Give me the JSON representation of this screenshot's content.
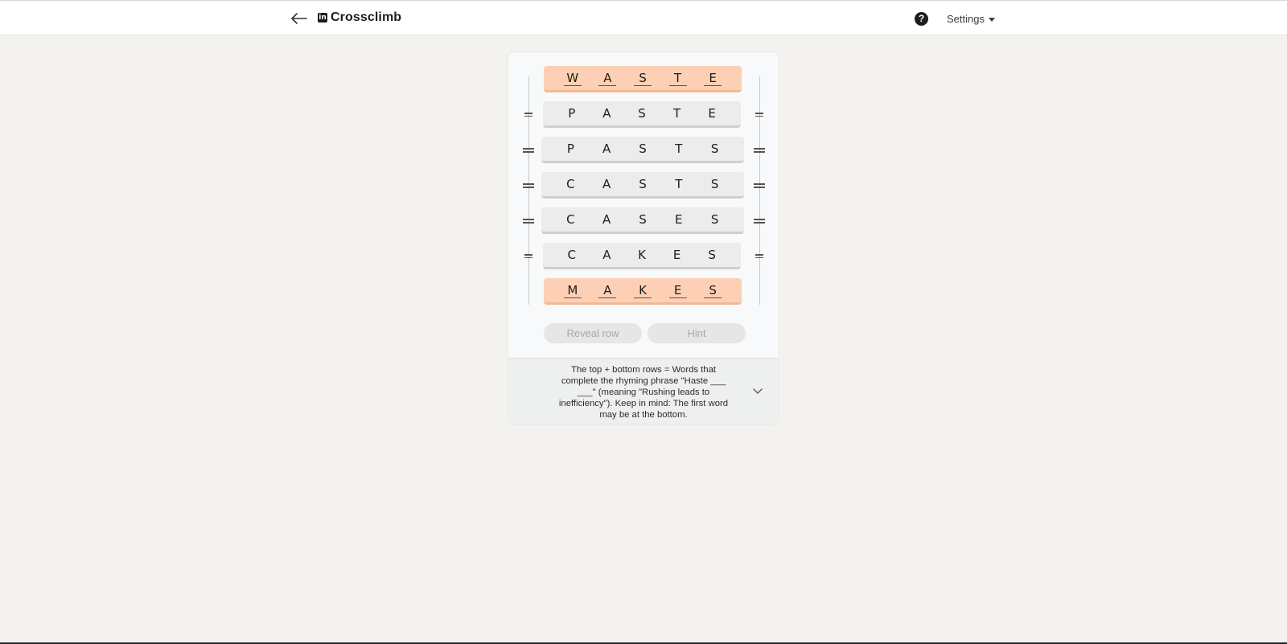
{
  "header": {
    "title": "Crossclimb",
    "logo_text": "in",
    "help_label": "?",
    "settings_label": "Settings"
  },
  "board": {
    "rows": [
      {
        "letters": [
          "W",
          "A",
          "S",
          "T",
          "E"
        ],
        "fixed": true
      },
      {
        "letters": [
          "P",
          "A",
          "S",
          "T",
          "E"
        ],
        "fixed": false
      },
      {
        "letters": [
          "P",
          "A",
          "S",
          "T",
          "S"
        ],
        "fixed": false
      },
      {
        "letters": [
          "C",
          "A",
          "S",
          "T",
          "S"
        ],
        "fixed": false
      },
      {
        "letters": [
          "C",
          "A",
          "S",
          "E",
          "S"
        ],
        "fixed": false
      },
      {
        "letters": [
          "C",
          "A",
          "K",
          "E",
          "S"
        ],
        "fixed": false
      },
      {
        "letters": [
          "M",
          "A",
          "K",
          "E",
          "S"
        ],
        "fixed": true
      }
    ]
  },
  "actions": {
    "reveal_label": "Reveal row",
    "hint_label": "Hint"
  },
  "clue": {
    "text": "The top + bottom rows = Words that complete the rhyming phrase \"Haste ___ ___\" (meaning \"Rushing leads to inefficiency\"). Keep in mind: The first word may be at the bottom."
  },
  "colors": {
    "fixed_row": "#fdd0b5",
    "movable_row": "#ececec",
    "page_background": "#f3f2ef"
  }
}
